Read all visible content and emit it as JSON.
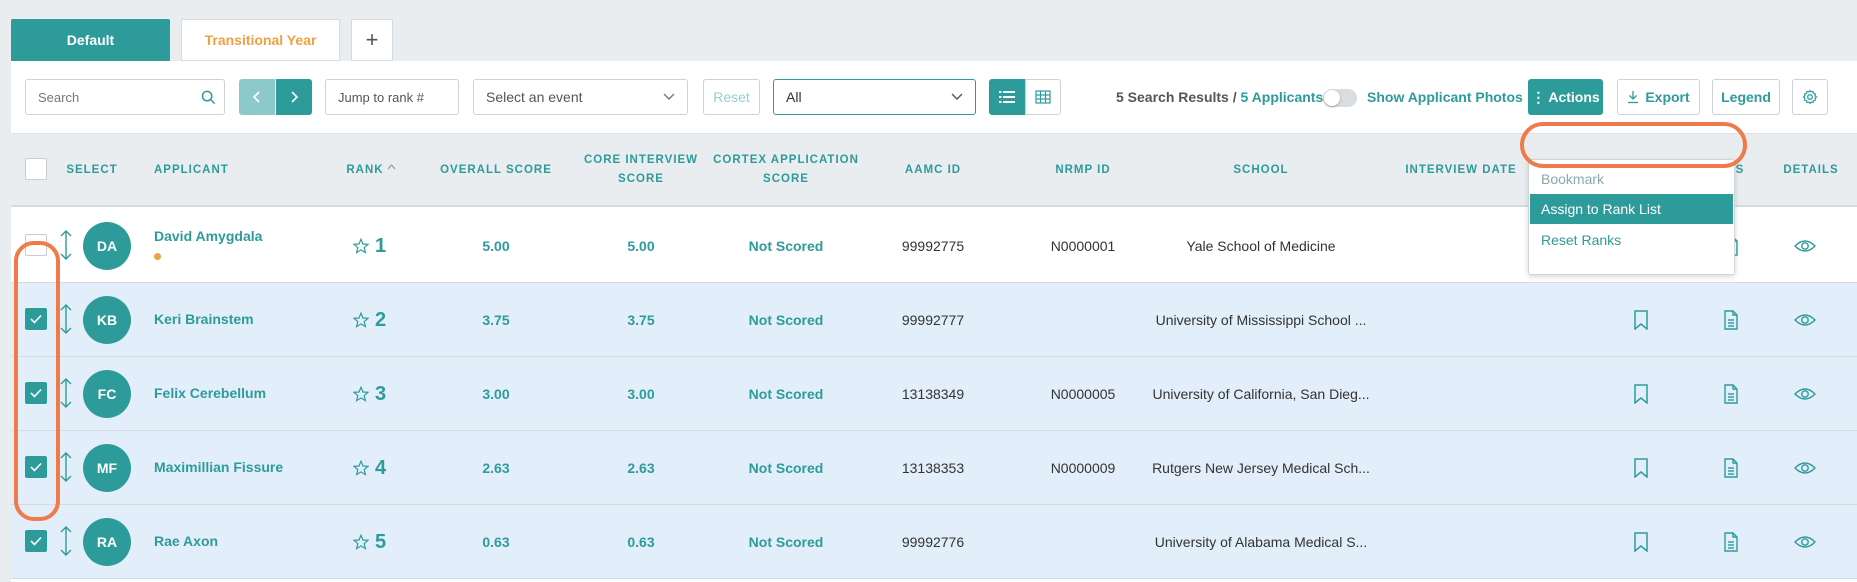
{
  "tabs": [
    {
      "label": "Default",
      "active": true
    },
    {
      "label": "Transitional Year",
      "active": false
    },
    {
      "label": "+",
      "active": false
    }
  ],
  "toolbar": {
    "search_placeholder": "Search",
    "jump_placeholder": "Jump to rank #",
    "event_placeholder": "Select an event",
    "reset_label": "Reset",
    "filter_value": "All",
    "results_text": "5 Search Results / ",
    "applicants_text": "5 Applicants",
    "photos_label": "Show Applicant Photos",
    "actions_label": "Actions",
    "export_label": "Export",
    "legend_label": "Legend"
  },
  "actions_menu": {
    "items": [
      "Bookmark",
      "Assign to Rank List",
      "Reset Ranks"
    ]
  },
  "table": {
    "headers": {
      "select": "SELECT",
      "applicant": "APPLICANT",
      "rank": "RANK",
      "overall": "OVERALL SCORE",
      "core1": "CORE INTERVIEW",
      "core2": "SCORE",
      "cortex1": "CORTEX APPLICATION",
      "cortex2": "SCORE",
      "aamc": "AAMC ID",
      "nrmp": "NRMP ID",
      "school": "SCHOOL",
      "interview": "INTERVIEW DATE",
      "notes_tail": "S",
      "details": "DETAILS"
    },
    "rows": [
      {
        "initials": "DA",
        "name": "David Amygdala",
        "rank": "1",
        "overall": "5.00",
        "core": "5.00",
        "cortex": "Not Scored",
        "aamc": "99992775",
        "nrmp": "N0000001",
        "school": "Yale School of Medicine",
        "checked": false
      },
      {
        "initials": "KB",
        "name": "Keri Brainstem",
        "rank": "2",
        "overall": "3.75",
        "core": "3.75",
        "cortex": "Not Scored",
        "aamc": "99992777",
        "nrmp": "",
        "school": "University of Mississippi School ...",
        "checked": true
      },
      {
        "initials": "FC",
        "name": "Felix Cerebellum",
        "rank": "3",
        "overall": "3.00",
        "core": "3.00",
        "cortex": "Not Scored",
        "aamc": "13138349",
        "nrmp": "N0000005",
        "school": "University of California, San Dieg...",
        "checked": true
      },
      {
        "initials": "MF",
        "name": "Maximillian Fissure",
        "rank": "4",
        "overall": "2.63",
        "core": "2.63",
        "cortex": "Not Scored",
        "aamc": "13138353",
        "nrmp": "N0000009",
        "school": "Rutgers New Jersey Medical Sch...",
        "checked": true
      },
      {
        "initials": "RA",
        "name": "Rae Axon",
        "rank": "5",
        "overall": "0.63",
        "core": "0.63",
        "cortex": "Not Scored",
        "aamc": "99992776",
        "nrmp": "",
        "school": "University of Alabama Medical S...",
        "checked": true
      }
    ]
  },
  "colors": {
    "accent": "#2e9b9b",
    "highlight": "#f07a4a",
    "selected_row": "#e2eef9"
  }
}
